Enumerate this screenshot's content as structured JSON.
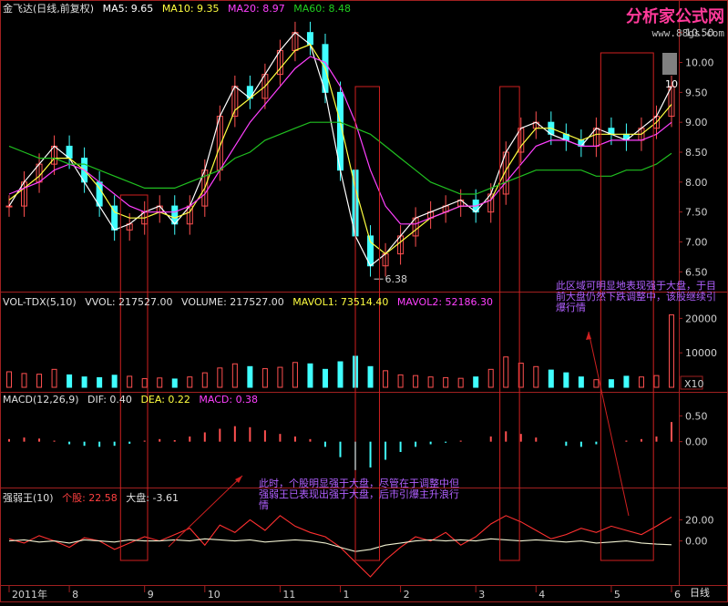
{
  "main_header": {
    "stock_name": "金飞达(日线,前复权)",
    "ma5": "MA5: 9.65",
    "ma10": "MA10: 9.35",
    "ma20": "MA20: 8.97",
    "ma60": "MA60: 8.48"
  },
  "vol_header": {
    "name": "VOL-TDX(5,10)",
    "vvol": "VVOL: 217527.00",
    "volume": "VOLUME: 217527.00",
    "mavol1": "MAVOL1: 73514.40",
    "mavol2": "MAVOL2: 52186.30"
  },
  "macd_header": {
    "name": "MACD(12,26,9)",
    "dif": "DIF: 0.40",
    "dea": "DEA: 0.22",
    "macd": "MACD: 0.38"
  },
  "ind_header": {
    "name": "强弱王(10)",
    "stock": "个股: 22.58",
    "market": "大盘: -3.61"
  },
  "logo": {
    "title": "分析家公式网",
    "url": "www.88gs.com"
  },
  "period_label": "日线",
  "annotations": {
    "right_note": "此区域可明显地表现强于大盘，于目前大盘仍然下跌调整中，该股继续引爆行情",
    "mid_note": "此时，个股明显强于大盘，尽管在于调整中但强弱王已表现出强于大盘，后市引爆主升浪行情"
  },
  "colors": {
    "ma5": "#ffffff",
    "ma10": "#ffff40",
    "ma20": "#ff40ff",
    "ma60": "#20c020",
    "up": "#ff5050",
    "down": "#40ffff",
    "box": "#d02020",
    "annotation": "#b060ff"
  },
  "chart_data": [
    {
      "type": "candlestick",
      "title": "金飞达(日线,前复权)",
      "x_labels": [
        "2011年",
        "8",
        "9",
        "10",
        "11",
        "1",
        "2",
        "3",
        "4",
        "5",
        "6"
      ],
      "y_ticks": [
        "6.50",
        "7.00",
        "7.50",
        "8.00",
        "8.50",
        "9.00",
        "9.50",
        "10.00",
        "10.50"
      ],
      "ylim": [
        6.2,
        10.8
      ],
      "price_marker": "6.38",
      "price_marker_right": "10",
      "series": [
        {
          "name": "MA5",
          "values": [
            7.6,
            8.0,
            8.3,
            8.6,
            8.4,
            8.0,
            7.6,
            7.2,
            7.3,
            7.5,
            7.6,
            7.3,
            7.6,
            8.2,
            9.1,
            9.6,
            9.4,
            9.8,
            10.2,
            10.5,
            10.3,
            9.5,
            8.2,
            7.1,
            6.6,
            6.8,
            7.1,
            7.4,
            7.5,
            7.6,
            7.7,
            7.5,
            7.8,
            8.5,
            8.9,
            9.0,
            8.8,
            8.7,
            8.6,
            8.9,
            8.8,
            8.7,
            8.9,
            9.1,
            9.6
          ]
        },
        {
          "name": "MA10",
          "values": [
            7.7,
            7.9,
            8.1,
            8.4,
            8.4,
            8.2,
            7.9,
            7.5,
            7.4,
            7.4,
            7.5,
            7.4,
            7.5,
            7.9,
            8.6,
            9.2,
            9.4,
            9.6,
            9.9,
            10.2,
            10.3,
            9.9,
            9.0,
            7.9,
            7.0,
            6.8,
            7.0,
            7.2,
            7.4,
            7.5,
            7.6,
            7.6,
            7.7,
            8.2,
            8.6,
            8.9,
            8.9,
            8.8,
            8.7,
            8.8,
            8.8,
            8.8,
            8.8,
            9.0,
            9.3
          ]
        },
        {
          "name": "MA20",
          "values": [
            7.8,
            7.9,
            8.0,
            8.2,
            8.3,
            8.2,
            8.0,
            7.8,
            7.6,
            7.5,
            7.5,
            7.5,
            7.6,
            7.8,
            8.2,
            8.6,
            9.0,
            9.3,
            9.6,
            9.9,
            10.1,
            10.0,
            9.6,
            9.0,
            8.2,
            7.6,
            7.3,
            7.3,
            7.4,
            7.5,
            7.6,
            7.6,
            7.7,
            8.0,
            8.3,
            8.6,
            8.7,
            8.7,
            8.6,
            8.6,
            8.7,
            8.7,
            8.7,
            8.8,
            9.0
          ]
        },
        {
          "name": "MA60",
          "values": [
            8.6,
            8.5,
            8.4,
            8.4,
            8.3,
            8.3,
            8.2,
            8.1,
            8.0,
            7.9,
            7.9,
            7.9,
            8.0,
            8.1,
            8.2,
            8.4,
            8.5,
            8.7,
            8.8,
            8.9,
            9.0,
            9.0,
            9.0,
            8.9,
            8.8,
            8.6,
            8.4,
            8.2,
            8.0,
            7.9,
            7.8,
            7.8,
            7.9,
            8.0,
            8.1,
            8.2,
            8.2,
            8.2,
            8.2,
            8.1,
            8.1,
            8.2,
            8.2,
            8.3,
            8.48
          ]
        }
      ]
    },
    {
      "type": "bar",
      "title": "VOL-TDX(5,10)",
      "y_ticks": [
        "10000",
        "20000"
      ],
      "unit_label": "X10",
      "ylim": [
        0,
        23000
      ],
      "values": [
        4500,
        4000,
        3800,
        5200,
        3600,
        3000,
        2800,
        3500,
        3200,
        2500,
        2700,
        2400,
        3000,
        4200,
        5600,
        6800,
        6000,
        5400,
        5800,
        7200,
        6800,
        5200,
        7400,
        9000,
        6000,
        4800,
        3600,
        3400,
        3000,
        2800,
        2600,
        3000,
        5200,
        8800,
        7000,
        6000,
        5000,
        4200,
        3000,
        2200,
        2200,
        3200,
        3000,
        3400,
        21000
      ]
    },
    {
      "type": "bar",
      "title": "MACD(12,26,9)",
      "y_ticks": [
        "0.00",
        "0.50"
      ],
      "ylim": [
        -0.8,
        0.7
      ],
      "values": [
        0.05,
        0.08,
        0.06,
        0.02,
        -0.05,
        -0.08,
        -0.1,
        -0.08,
        -0.04,
        0.02,
        0.05,
        0.03,
        0.1,
        0.18,
        0.25,
        0.3,
        0.28,
        0.22,
        0.15,
        0.1,
        0.05,
        -0.1,
        -0.3,
        -0.55,
        -0.5,
        -0.35,
        -0.2,
        -0.1,
        -0.05,
        -0.02,
        0.02,
        0.0,
        0.1,
        0.2,
        0.15,
        0.08,
        0.0,
        -0.08,
        -0.1,
        -0.05,
        0.0,
        0.02,
        0.05,
        0.1,
        0.38
      ]
    },
    {
      "type": "line",
      "title": "强弱王(10)",
      "y_ticks": [
        "0.00",
        "20.00"
      ],
      "ylim": [
        -40,
        35
      ],
      "series": [
        {
          "name": "个股",
          "values": [
            2,
            -2,
            5,
            0,
            -6,
            3,
            0,
            -8,
            -2,
            4,
            0,
            6,
            12,
            -4,
            15,
            8,
            20,
            10,
            24,
            14,
            8,
            4,
            -6,
            -20,
            -34,
            -18,
            -6,
            4,
            0,
            8,
            -4,
            4,
            16,
            24,
            18,
            10,
            2,
            6,
            12,
            8,
            14,
            10,
            6,
            14,
            22.58
          ]
        },
        {
          "name": "大盘",
          "values": [
            0,
            1,
            -1,
            0,
            -2,
            1,
            0,
            -1,
            1,
            0,
            0,
            1,
            0,
            2,
            1,
            0,
            1,
            -1,
            0,
            1,
            0,
            -2,
            -6,
            -10,
            -8,
            -4,
            -2,
            0,
            1,
            0,
            1,
            0,
            2,
            1,
            0,
            1,
            0,
            -1,
            0,
            -2,
            -1,
            0,
            -2,
            -3,
            -3.61
          ]
        }
      ]
    }
  ]
}
